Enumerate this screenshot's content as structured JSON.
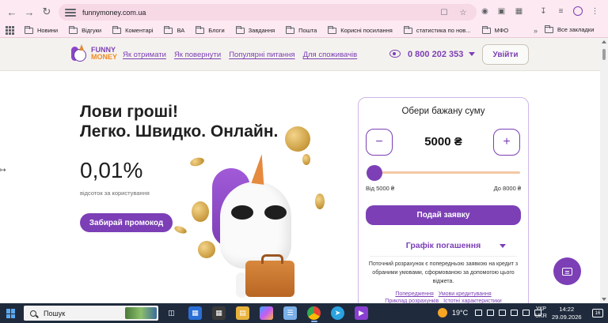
{
  "browser": {
    "url": "funnymoney.com.ua",
    "bookmarks": [
      "Новини",
      "Відгуки",
      "Коментарі",
      "ВА",
      "Блоги",
      "Завдання",
      "Пошта",
      "Корисні посилання",
      "статистика по нов...",
      "МФО"
    ],
    "all_bookmarks": "Все закладки"
  },
  "site": {
    "logo_line1": "FUNNY",
    "logo_line2": "MONEY",
    "nav": [
      "Як отримати",
      "Як повернути",
      "Популярні питання",
      "Для споживачів"
    ],
    "phone": "0 800 202 353",
    "login_label": "Увійти"
  },
  "hero": {
    "title_line1": "Лови гроші!",
    "title_line2": "Легко. Швидко. Онлайн.",
    "rate": "0,01%",
    "rate_caption": "відсоток за користування",
    "promo_button": "Забирай промокод"
  },
  "calculator": {
    "title": "Обери бажану суму",
    "minus": "−",
    "plus": "+",
    "amount": "5000 ₴",
    "slider_value_fraction": 0.0,
    "range_min": "Від 5000 ₴",
    "range_max": "До 8000 ₴",
    "submit": "Подай заявку",
    "schedule_toggle": "Графік погашення",
    "note": "Поточний розрахунок є попередньою заявкою на кредит з обраними умовами, сформованою за допомогою цього віджета.",
    "links_row1": [
      "Попередження",
      "Умови кредитування"
    ],
    "links_row2": [
      "Приклад розрахунків",
      "Істотні характеристики"
    ]
  },
  "taskbar": {
    "search_label": "Пошук",
    "weather": "19°C",
    "lang_line1": "УКР",
    "lang_line2": "UKR",
    "time": "14:22",
    "date": "29.09.2026",
    "notifications": "16"
  },
  "colors": {
    "brand_purple": "#7c3fb6",
    "brand_orange": "#f08a22",
    "chrome_pink": "#fde9f1"
  }
}
